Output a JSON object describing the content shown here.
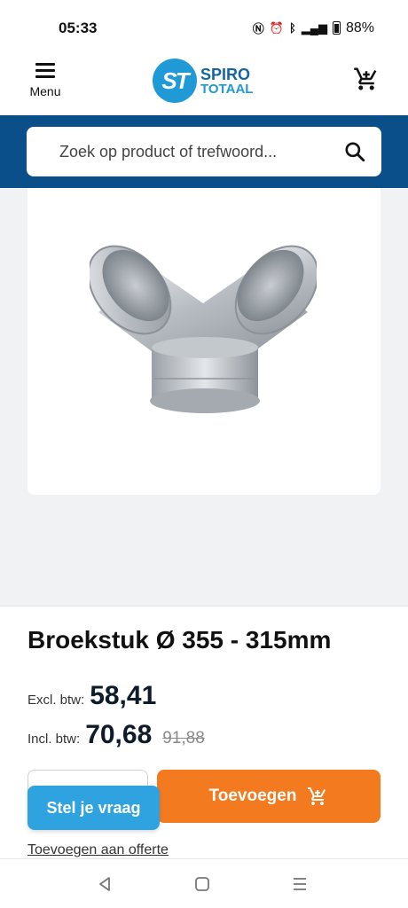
{
  "status_bar": {
    "time": "05:33",
    "icons": [
      "nfc-icon",
      "alarm-icon",
      "bluetooth-icon",
      "signal-5g-icon",
      "battery-icon"
    ],
    "battery": "88%"
  },
  "header": {
    "menu_label": "Menu",
    "logo_line1": "SPIRO",
    "logo_line2": "TOTAAL",
    "logo_mark": "ST",
    "brand_color": "#1f9ad6"
  },
  "search": {
    "placeholder": "Zoek op product of trefwoord...",
    "band_color": "#0b4f8a"
  },
  "product": {
    "title": "Broekstuk Ø 355 - 315mm",
    "excl_label": "Excl. btw:",
    "excl_price": "58,41",
    "incl_label": "Incl. btw:",
    "incl_price": "70,68",
    "old_price": "91,88"
  },
  "actions": {
    "add_label": "Toevoegen",
    "add_color": "#f47a1f",
    "ask_label": "Stel je vraag",
    "ask_color": "#2fa3e0",
    "offerte_label": "Toevoegen aan offerte"
  },
  "nav_bar": {
    "buttons": [
      "back-icon",
      "home-icon",
      "recents-icon"
    ]
  }
}
